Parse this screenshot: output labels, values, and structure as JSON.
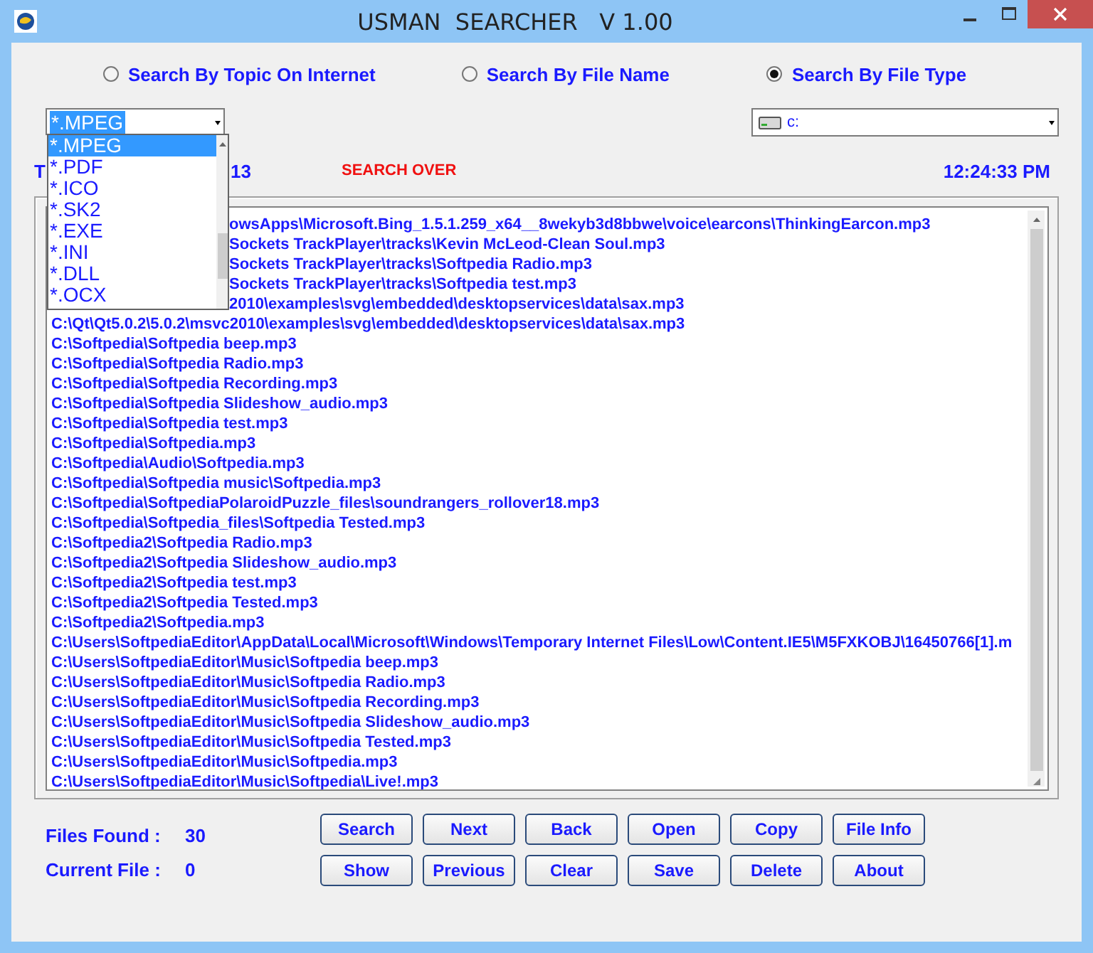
{
  "window": {
    "title": "USMAN  SEARCHER   V 1.00"
  },
  "search_modes": [
    {
      "label": "Search By Topic On Internet",
      "selected": false
    },
    {
      "label": "Search By File Name",
      "selected": false
    },
    {
      "label": "Search By File Type",
      "selected": true
    }
  ],
  "file_type": {
    "value": "*.MPEG",
    "items": [
      {
        "label": "*.MPEG",
        "selected": true
      },
      {
        "label": "*.PDF",
        "selected": false
      },
      {
        "label": "*.ICO",
        "selected": false
      },
      {
        "label": "*.SK2",
        "selected": false
      },
      {
        "label": "*.EXE",
        "selected": false
      },
      {
        "label": "*.INI",
        "selected": false
      },
      {
        "label": "*.DLL",
        "selected": false
      },
      {
        "label": "*.OCX",
        "selected": false
      }
    ]
  },
  "drive": {
    "value": "c:"
  },
  "date_start": "T",
  "date_end": "13",
  "status": "SEARCH OVER",
  "time": "12:24:33 PM",
  "partly_hidden_results": [
    "owsApps\\Microsoft.Bing_1.5.1.259_x64__8wekyb3d8bbwe\\voice\\earcons\\ThinkingEarcon.mp3",
    "Sockets TrackPlayer\\tracks\\Kevin McLeod-Clean Soul.mp3",
    "Sockets TrackPlayer\\tracks\\Softpedia Radio.mp3",
    "Sockets TrackPlayer\\tracks\\Softpedia test.mp3",
    "2010\\examples\\svg\\embedded\\desktopservices\\data\\sax.mp3"
  ],
  "results": [
    "C:\\Qt\\Qt5.0.2\\5.0.2\\msvc2010\\examples\\svg\\embedded\\desktopservices\\data\\sax.mp3",
    "C:\\Softpedia\\Softpedia beep.mp3",
    "C:\\Softpedia\\Softpedia Radio.mp3",
    "C:\\Softpedia\\Softpedia Recording.mp3",
    "C:\\Softpedia\\Softpedia Slideshow_audio.mp3",
    "C:\\Softpedia\\Softpedia test.mp3",
    "C:\\Softpedia\\Softpedia.mp3",
    "C:\\Softpedia\\Audio\\Softpedia.mp3",
    "C:\\Softpedia\\Softpedia music\\Softpedia.mp3",
    "C:\\Softpedia\\SoftpediaPolaroidPuzzle_files\\soundrangers_rollover18.mp3",
    "C:\\Softpedia\\Softpedia_files\\Softpedia Tested.mp3",
    "C:\\Softpedia2\\Softpedia Radio.mp3",
    "C:\\Softpedia2\\Softpedia Slideshow_audio.mp3",
    "C:\\Softpedia2\\Softpedia test.mp3",
    "C:\\Softpedia2\\Softpedia Tested.mp3",
    "C:\\Softpedia2\\Softpedia.mp3",
    "C:\\Users\\SoftpediaEditor\\AppData\\Local\\Microsoft\\Windows\\Temporary Internet Files\\Low\\Content.IE5\\M5FXKOBJ\\16450766[1].m",
    "C:\\Users\\SoftpediaEditor\\Music\\Softpedia beep.mp3",
    "C:\\Users\\SoftpediaEditor\\Music\\Softpedia Radio.mp3",
    "C:\\Users\\SoftpediaEditor\\Music\\Softpedia Recording.mp3",
    "C:\\Users\\SoftpediaEditor\\Music\\Softpedia Slideshow_audio.mp3",
    "C:\\Users\\SoftpediaEditor\\Music\\Softpedia Tested.mp3",
    "C:\\Users\\SoftpediaEditor\\Music\\Softpedia.mp3",
    "C:\\Users\\SoftpediaEditor\\Music\\Softpedia\\Live!.mp3"
  ],
  "files_found": {
    "label": "Files Found :",
    "value": "30"
  },
  "current_file": {
    "label": "Current File :",
    "value": "0"
  },
  "buttons": [
    [
      "Search",
      "Next",
      "Back",
      "Open",
      "Copy",
      "File Info"
    ],
    [
      "Show",
      "Previous",
      "Clear",
      "Save",
      "Delete",
      "About"
    ]
  ]
}
